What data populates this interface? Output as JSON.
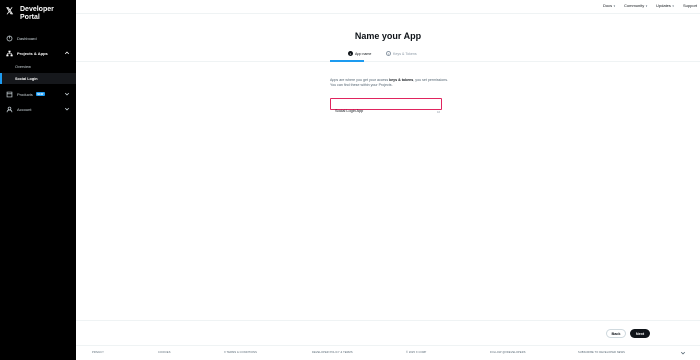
{
  "sidebar": {
    "logo_glyph": "𝕏",
    "portal_title": "Developer Portal",
    "items": [
      {
        "label": "Dashboard",
        "icon": "circle-icon"
      },
      {
        "label": "Projects & Apps",
        "icon": "hierarchy-icon",
        "expanded": true
      },
      {
        "label": "Products",
        "icon": "products-icon",
        "badge": "NEW"
      },
      {
        "label": "Account",
        "icon": "account-icon"
      }
    ],
    "subitems": [
      "Overview",
      "Social Login"
    ]
  },
  "topbar": {
    "links": [
      "Docs",
      "Community",
      "Updates",
      "Support"
    ]
  },
  "page": {
    "title": "Name your App",
    "steps": [
      {
        "num": "1",
        "label": "App name"
      },
      {
        "num": "2",
        "label": "Keys & Tokens"
      }
    ],
    "description_prefix": "Apps are where you get your access ",
    "description_bold": "keys & tokens",
    "description_suffix": ", you set permissions. You can find these within your Projects.",
    "app_name_value": "Social Login App",
    "char_counter": "16"
  },
  "actions": {
    "back_label": "Back",
    "next_label": "Next"
  },
  "footer": {
    "links": [
      "PRIVACY",
      "COOKIES",
      "X TERMS & CONDITIONS",
      "DEVELOPER POLICY & TERMS",
      "© 2025 X CORP",
      "FOLLOW @XDEVELOPERS",
      "SUBSCRIBE TO DEVELOPER NEWS"
    ],
    "accent": "#1d9bf0"
  },
  "colors": {
    "accent": "#1d9bf0",
    "error_border": "#e0245e",
    "sidebar_bg": "#000000"
  }
}
